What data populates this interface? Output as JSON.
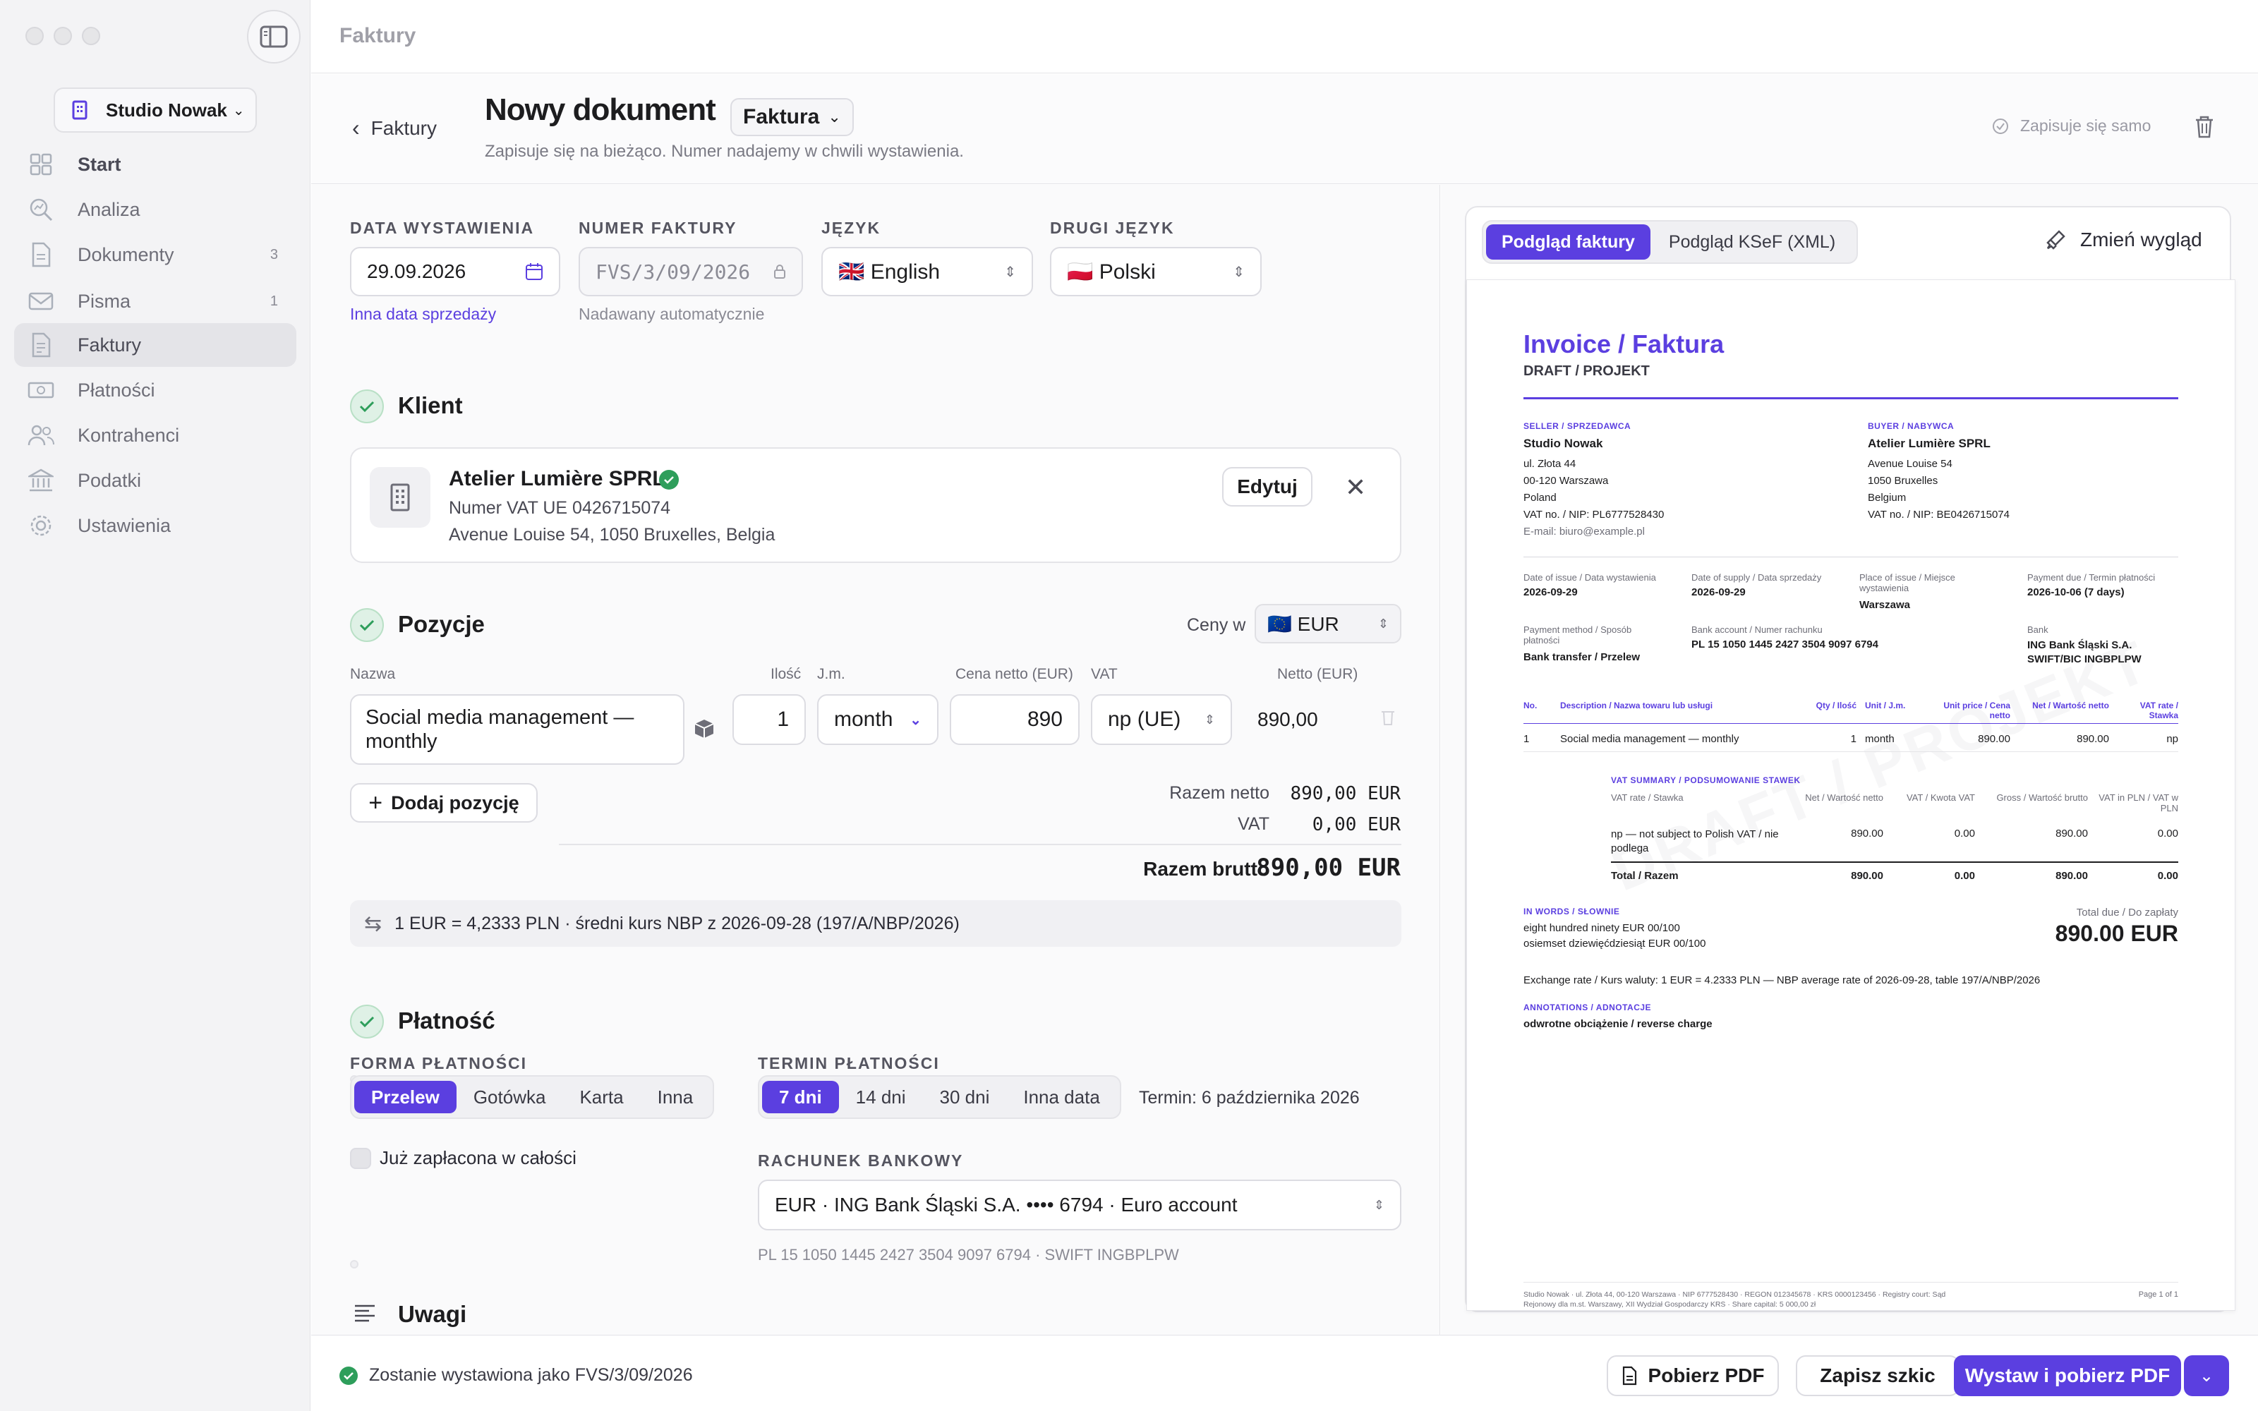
{
  "window": {
    "title": "Faktury"
  },
  "sidebar": {
    "company": "Studio Nowak",
    "items": [
      {
        "label": "Start",
        "count": "",
        "icon": "grid-icon"
      },
      {
        "label": "Analiza",
        "count": "",
        "icon": "magnifier-chart-icon"
      },
      {
        "label": "Dokumenty",
        "count": "3",
        "icon": "document-icon"
      },
      {
        "label": "Pisma",
        "count": "1",
        "icon": "envelope-icon"
      },
      {
        "label": "Faktury",
        "count": "",
        "icon": "invoice-icon"
      },
      {
        "label": "Płatności",
        "count": "",
        "icon": "banknote-icon"
      },
      {
        "label": "Kontrahenci",
        "count": "",
        "icon": "people-icon"
      },
      {
        "label": "Podatki",
        "count": "",
        "icon": "bank-building-icon"
      },
      {
        "label": "Ustawienia",
        "count": "",
        "icon": "gear-icon"
      }
    ]
  },
  "header": {
    "back_label": "Faktury",
    "title": "Nowy dokument",
    "doc_type": "Faktura",
    "subtitle": "Zapisuje się na bieżąco. Numer nadajemy w chwili wystawienia.",
    "autosave": "Zapisuje się samo"
  },
  "form": {
    "issue_date_label": "DATA WYSTAWIENIA",
    "issue_date": "29.09.2026",
    "sale_date_link": "Inna data sprzedaży",
    "number_label": "NUMER FAKTURY",
    "number": "FVS/3/09/2026",
    "number_hint": "Nadawany automatycznie",
    "language_label": "JĘZYK",
    "language": "English",
    "language_flag": "🇬🇧",
    "second_language_label": "DRUGI JĘZYK",
    "second_language": "Polski",
    "second_language_flag": "🇵🇱"
  },
  "client": {
    "section_title": "Klient",
    "name": "Atelier Lumière SPRL",
    "vat": "Numer VAT UE 0426715074",
    "address": "Avenue Louise 54, 1050 Bruxelles, Belgia",
    "edit_label": "Edytuj"
  },
  "items": {
    "section_title": "Pozycje",
    "prices_label": "Ceny w",
    "currency": "EUR",
    "currency_flag": "🇪🇺",
    "col_name": "Nazwa",
    "col_qty": "Ilość",
    "col_unit": "J.m.",
    "col_price": "Cena netto (EUR)",
    "col_vat": "VAT",
    "col_net": "Netto (EUR)",
    "rows": [
      {
        "name": "Social media management — monthly",
        "qty": "1",
        "unit": "month",
        "price": "890",
        "vat": "np (UE)",
        "net": "890,00"
      }
    ],
    "add_label": "Dodaj pozycję",
    "total_net_label": "Razem netto",
    "total_net": "890,00 EUR",
    "vat_label": "VAT",
    "vat_total": "0,00 EUR",
    "gross_label": "Razem brutto",
    "gross_total": "890,00 EUR",
    "exchange": "1 EUR = 4,2333 PLN · średni kurs NBP z 2026-09-28 (197/A/NBP/2026)"
  },
  "payment": {
    "section_title": "Płatność",
    "method_label": "FORMA PŁATNOŚCI",
    "methods": [
      "Przelew",
      "Gotówka",
      "Karta",
      "Inna"
    ],
    "term_label": "TERMIN PŁATNOŚCI",
    "terms": [
      "7 dni",
      "14 dni",
      "30 dni",
      "Inna data"
    ],
    "due_text": "Termin: 6 października 2026",
    "paid_label": "Już zapłacona w całości",
    "bank_label": "RACHUNEK BANKOWY",
    "bank_account": "EUR · ING Bank Śląski S.A. •••• 6794 · Euro account",
    "bank_hint": "PL 15 1050 1445 2427 3504 9097 6794 · SWIFT INGBPLPW"
  },
  "notes": {
    "section_title": "Uwagi"
  },
  "preview": {
    "tabs": [
      "Podgląd faktury",
      "Podgląd KSeF (XML)"
    ],
    "appearance_label": "Zmień wygląd",
    "watermark": "DRAFT / PROJEKT",
    "title": "Invoice / Faktura",
    "subtitle": "DRAFT / PROJEKT",
    "seller_h": "SELLER / SPRZEDAWCA",
    "seller": [
      "Studio Nowak",
      "ul. Złota 44",
      "00-120 Warszawa",
      "Poland",
      "VAT no. / NIP: PL6777528430",
      "E-mail: biuro@example.pl"
    ],
    "buyer_h": "BUYER / NABYWCA",
    "buyer": [
      "Atelier Lumière SPRL",
      "Avenue Louise 54",
      "1050 Bruxelles",
      "Belgium",
      "VAT no. / NIP: BE0426715074"
    ],
    "meta1": [
      {
        "label": "Date of issue / Data wystawienia",
        "value": "2026-09-29"
      },
      {
        "label": "Date of supply / Data sprzedaży",
        "value": "2026-09-29"
      },
      {
        "label": "Place of issue / Miejsce wystawienia",
        "value": "Warszawa"
      },
      {
        "label": "Payment due / Termin płatności",
        "value": "2026-10-06 (7 days)"
      }
    ],
    "meta2": [
      {
        "label": "Payment method / Sposób płatności",
        "value": "Bank transfer / Przelew"
      },
      {
        "label": "Bank account / Numer rachunku",
        "value": "PL 15 1050 1445 2427 3504 9097 6794"
      },
      {
        "label": "Bank",
        "value": "ING Bank Śląski S.A. SWIFT/BIC INGBPLPW"
      }
    ],
    "table_head": [
      "No.",
      "Description / Nazwa towaru lub usługi",
      "Qty / Ilość",
      "Unit / J.m.",
      "Unit price / Cena netto",
      "Net / Wartość netto",
      "VAT rate / Stawka"
    ],
    "table_row": [
      "1",
      "Social media management — monthly",
      "1",
      "month",
      "890.00",
      "890.00",
      "np"
    ],
    "vat_h": "VAT SUMMARY / PODSUMOWANIE STAWEK",
    "vat_head": [
      "VAT rate / Stawka",
      "Net / Wartość netto",
      "VAT / Kwota VAT",
      "Gross / Wartość brutto",
      "VAT in PLN / VAT w PLN"
    ],
    "vat_row": [
      "np — not subject to Polish VAT / nie podlega",
      "890.00",
      "0.00",
      "890.00",
      "0.00"
    ],
    "vat_total": [
      "Total / Razem",
      "890.00",
      "0.00",
      "890.00",
      "0.00"
    ],
    "words_h": "IN WORDS / SŁOWNIE",
    "words": [
      "eight hundred ninety EUR 00/100",
      "osiemset dziewięćdziesiąt EUR 00/100"
    ],
    "due_label": "Total due / Do zapłaty",
    "due_amount": "890.00 EUR",
    "exchange": "Exchange rate / Kurs waluty: 1 EUR = 4.2333 PLN — NBP average rate of 2026-09-28, table 197/A/NBP/2026",
    "annot_h": "ANNOTATIONS / ADNOTACJE",
    "annot": "odwrotne obciążenie / reverse charge",
    "footer": [
      "Studio Nowak · ul. Złota 44, 00-120 Warszawa · NIP 6777528430 · REGON 012345678 · KRS 0000123456 · Registry court: Sąd",
      "Rejonowy dla m.st. Warszawy, XII Wydział Gospodarczy KRS · Share capital: 5 000,00 zł"
    ],
    "page": "Page 1 of 1"
  },
  "footer": {
    "status": "Zostanie wystawiona jako FVS/3/09/2026",
    "pdf_label": "Pobierz PDF",
    "draft_label": "Zapisz szkic",
    "issue_label": "Wystaw i pobierz PDF"
  },
  "colors": {
    "accent": "#5b3fe0",
    "success": "#2e9e5b",
    "sidebar_bg": "#f3f3f5"
  }
}
